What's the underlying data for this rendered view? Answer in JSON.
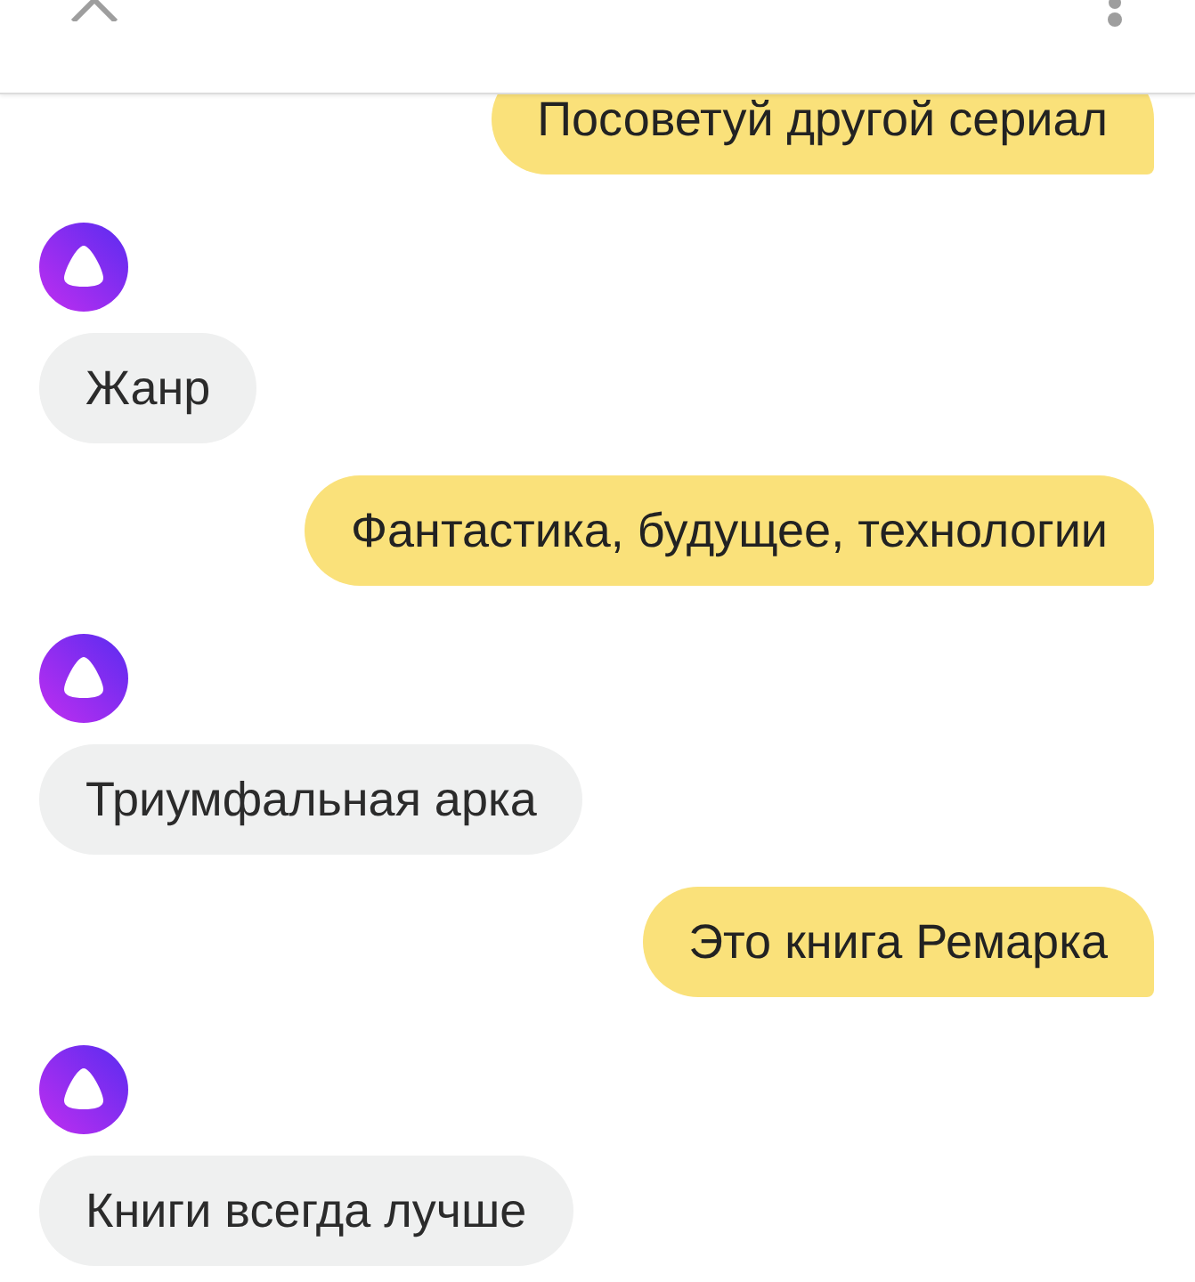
{
  "messages": [
    {
      "kind": "user",
      "text": "Посоветуй другой сериал"
    },
    {
      "kind": "assistant",
      "text": "Жанр"
    },
    {
      "kind": "user",
      "text": "Фантастика, будущее, технологии"
    },
    {
      "kind": "assistant",
      "text": "Триумфальная арка"
    },
    {
      "kind": "user",
      "text": "Это книга Ремарка"
    },
    {
      "kind": "assistant",
      "text": "Книги всегда лучше"
    }
  ]
}
